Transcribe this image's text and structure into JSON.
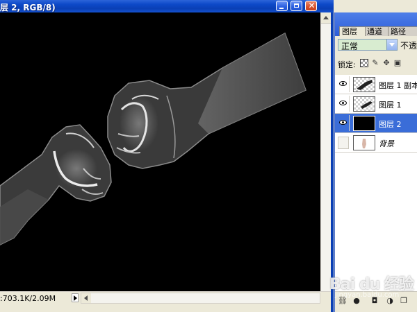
{
  "document": {
    "title": "层 2, RGB/8)",
    "status_text": ":703.1K/2.09M"
  },
  "panel": {
    "tabs": [
      {
        "label": "图层",
        "active": true
      },
      {
        "label": "通道",
        "active": false
      },
      {
        "label": "路径",
        "active": false
      }
    ],
    "blend_mode": "正常",
    "opacity_label": "不透",
    "lock_label": "锁定:",
    "layers": [
      {
        "name": "图层 1 副本",
        "visible": true,
        "selected": false,
        "thumbnail": "checker-with-fist"
      },
      {
        "name": "图层 1",
        "visible": true,
        "selected": false,
        "thumbnail": "checker-with-fist"
      },
      {
        "name": "图层 2",
        "visible": true,
        "selected": true,
        "thumbnail": "black-fill"
      },
      {
        "name": "背景",
        "visible": false,
        "selected": false,
        "thumbnail": "white-with-hand"
      }
    ]
  },
  "watermark": {
    "text": "Bai du 经验",
    "sub": "jingyan.baidu.com"
  },
  "colors": {
    "title_bar": "#0a3fb5",
    "selected_layer": "#3a6dd8",
    "canvas": "#000000"
  }
}
